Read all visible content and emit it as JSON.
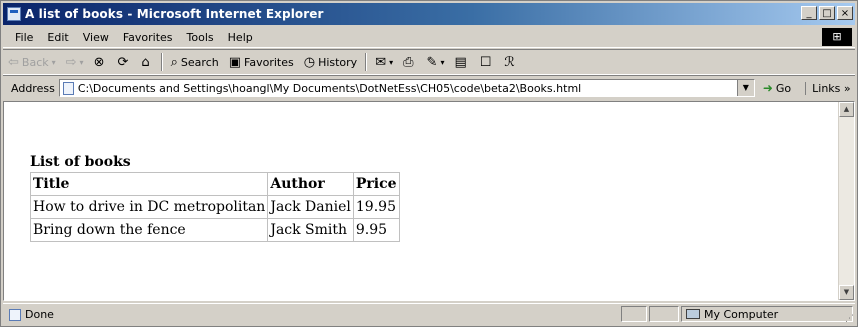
{
  "window": {
    "title": "A list of books - Microsoft Internet Explorer"
  },
  "menu": [
    "File",
    "Edit",
    "View",
    "Favorites",
    "Tools",
    "Help"
  ],
  "toolbar": {
    "back_label": "Back",
    "search_label": "Search",
    "favorites_label": "Favorites",
    "history_label": "History"
  },
  "address": {
    "label": "Address",
    "value": "C:\\Documents and Settings\\hoangl\\My Documents\\DotNetEss\\CH05\\code\\beta2\\Books.html",
    "go_label": "Go",
    "links_label": "Links"
  },
  "page": {
    "heading": "List of books",
    "columns": [
      "Title",
      "Author",
      "Price"
    ],
    "rows": [
      [
        "How to drive in DC metropolitan",
        "Jack Daniel",
        "19.95"
      ],
      [
        "Bring down the fence",
        "Jack Smith",
        "9.95"
      ]
    ]
  },
  "status": {
    "text": "Done",
    "zone": "My Computer"
  }
}
